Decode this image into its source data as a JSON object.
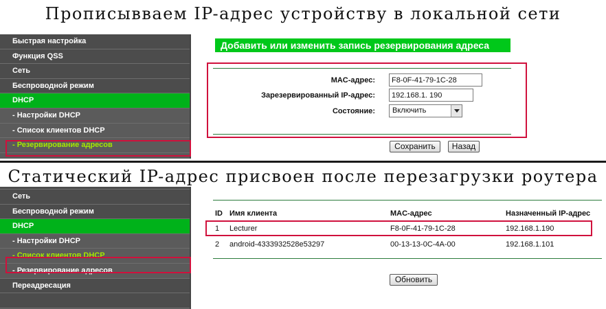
{
  "top_caption": "Прописывваем IP-адрес устройству в локальной сети",
  "bottom_caption": "Статический IP-адрес присвоен после перезагрузки роутера",
  "top_sidebar": {
    "items": [
      {
        "label": "Быстрая настройка"
      },
      {
        "label": "Функция QSS"
      },
      {
        "label": "Сеть"
      },
      {
        "label": "Беспроводной режим"
      },
      {
        "label": "DHCP"
      },
      {
        "label": "- Настройки DHCP"
      },
      {
        "label": "- Список клиентов DHCP"
      },
      {
        "label": "- Резервирование адресов"
      }
    ]
  },
  "form": {
    "title": "Добавить или изменить запись резервирования адреса",
    "mac_label": "MAC-адрес:",
    "mac_value": "F8-0F-41-79-1C-28",
    "ip_label": "Зарезервированный IP-адрес:",
    "ip_value": "192.168.1. 190",
    "state_label": "Состояние:",
    "state_value": "Включить",
    "save_label": "Сохранить",
    "back_label": "Назад"
  },
  "bottom_sidebar": {
    "items": [
      {
        "label": "Сеть"
      },
      {
        "label": "Беспроводной режим"
      },
      {
        "label": "DHCP"
      },
      {
        "label": "- Настройки DHCP"
      },
      {
        "label": "- Список клиентов DHCP"
      },
      {
        "label": "- Резервирование адресов"
      },
      {
        "label": "Переадресация"
      }
    ]
  },
  "clients_table": {
    "headers": {
      "id": "ID",
      "name": "Имя клиента",
      "mac": "MAC-адрес",
      "ip": "Назначенный IP-адрес"
    },
    "rows": [
      {
        "id": "1",
        "name": "Lecturer",
        "mac": "F8-0F-41-79-1C-28",
        "ip": "192.168.1.190"
      },
      {
        "id": "2",
        "name": "android-4333932528e53297",
        "mac": "00-13-13-0C-4A-00",
        "ip": "192.168.1.101"
      }
    ],
    "refresh_label": "Обновить"
  },
  "colors": {
    "accent_green": "#00b21a",
    "active_link": "#a6e800",
    "highlight_red": "#d0103c",
    "sidebar_bg": "#4c4c4c"
  }
}
